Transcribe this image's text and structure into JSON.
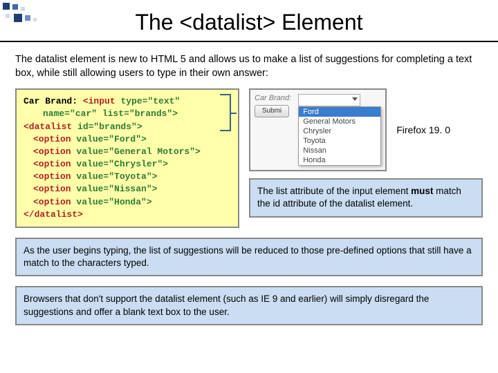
{
  "title": "The <datalist> Element",
  "intro": "The datalist element is new to HTML 5 and allows us to make a list of suggestions for completing a text box, while still allowing users to type in their own answer:",
  "code": {
    "line1_a": "Car Brand: ",
    "line1_b": "<input",
    "line1_c": " type=\"text\"",
    "line2": "name=\"car\" list=\"brands\">",
    "line3_a": "<datalist",
    "line3_b": " id=\"brands\">",
    "opt_tag": "<option",
    "opt_values": [
      "Ford",
      "General Motors",
      "Chrysler",
      "Toyota",
      "Nissan",
      "Honda"
    ],
    "close_tag": "</datalist>"
  },
  "demo": {
    "label": "Car Brand:",
    "submit": "Submi",
    "options": [
      "Ford",
      "General Motors",
      "Chrysler",
      "Toyota",
      "Nissan",
      "Honda"
    ],
    "browser": "Firefox 19. 0"
  },
  "note1_a": "The list attribute of the input element ",
  "note1_b": "must",
  "note1_c": " match the id attribute of the datalist element.",
  "note2": "As the user begins typing, the list of suggestions will be reduced to those pre-defined options that still have a match to the characters typed.",
  "note3": "Browsers that don't support the datalist element (such as IE 9 and earlier) will simply disregard the suggestions and offer a blank text box to the user."
}
